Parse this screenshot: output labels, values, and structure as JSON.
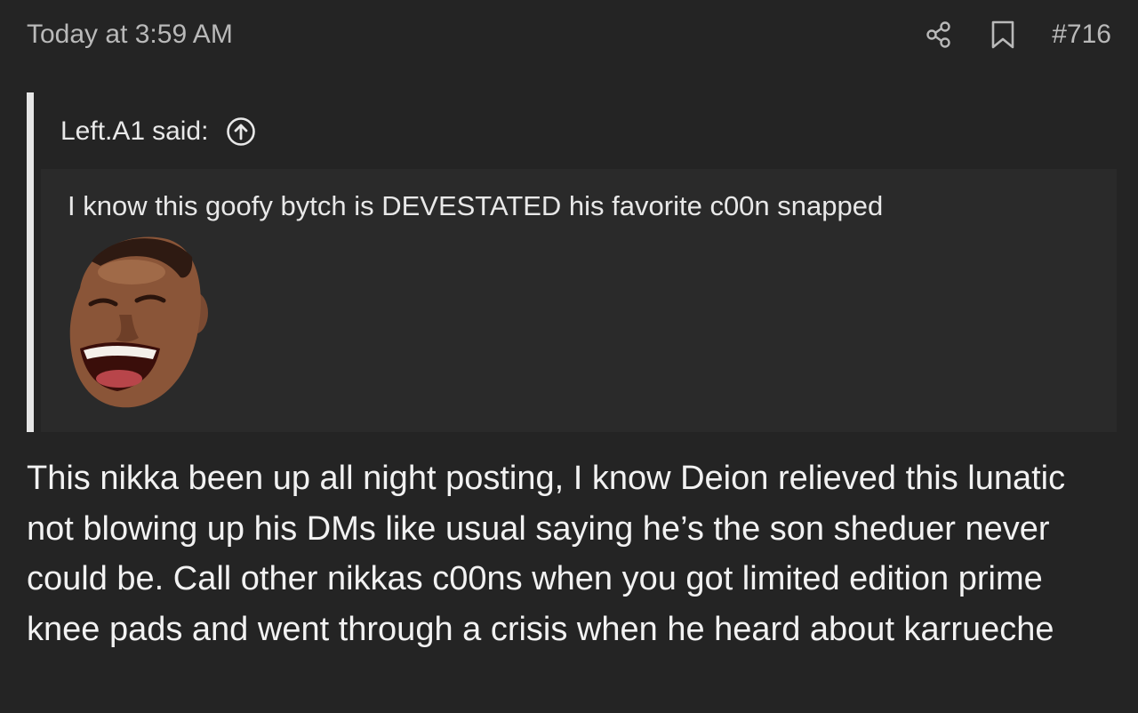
{
  "post": {
    "timestamp": "Today at 3:59 AM",
    "number": "#716",
    "icons": {
      "share": "share-icon",
      "bookmark": "bookmark-icon"
    },
    "quote": {
      "author": "Left.A1",
      "said": "said:",
      "jump_icon": "arrow-up-circle-icon",
      "text": "I know this goofy bytch is DEVESTATED his favorite c00n snapped",
      "image": "laughing-face-emoji"
    },
    "body": "This nikka been up all night posting, I know Deion relieved this lunatic not blowing up his DMs like usual saying he’s the son sheduer never could be. Call other nikkas c00ns when you got limited edition prime knee pads and went through a crisis when he heard about karrueche"
  },
  "colors": {
    "background": "#242424",
    "quote_background": "#2a2a2a",
    "quote_border": "#e6e6e6",
    "muted_text": "#b9b9b9",
    "text": "#e8e8e8"
  }
}
